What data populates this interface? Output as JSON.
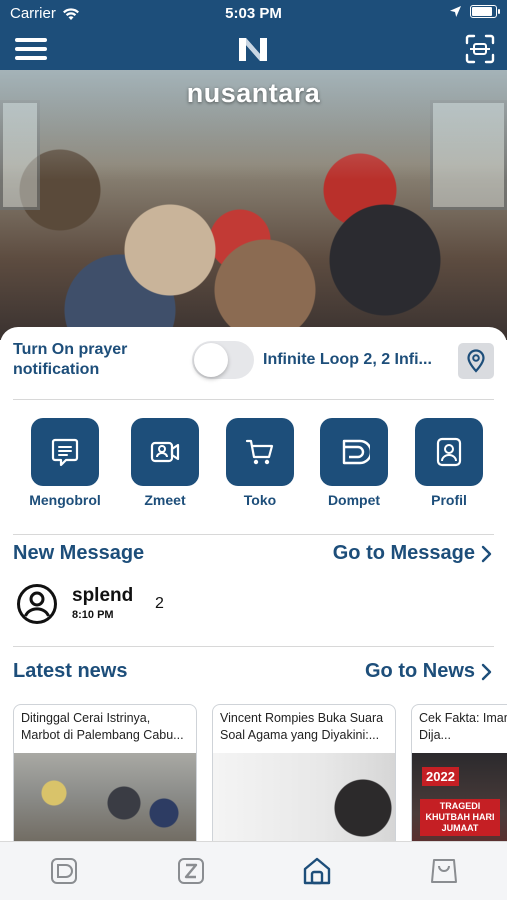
{
  "status_bar": {
    "carrier": "Carrier",
    "time": "5:03 PM",
    "battery_level": 0.9,
    "icons": [
      "wifi-icon",
      "location-arrow-icon",
      "battery-icon"
    ]
  },
  "header": {
    "menu_icon": "hamburger-menu-icon",
    "logo_icon": "n-logo-icon",
    "scan_icon": "qr-scan-icon",
    "background_color": "#1d4e7a"
  },
  "hero": {
    "title": "nusantara"
  },
  "prayer": {
    "label": "Turn On prayer notification",
    "toggle_on": false,
    "location": "Infinite Loop 2, 2 Infi...",
    "location_icon": "map-pin-icon"
  },
  "quick_actions": [
    {
      "label": "Mengobrol",
      "icon": "chat-icon"
    },
    {
      "label": "Zmeet",
      "icon": "video-call-icon"
    },
    {
      "label": "Toko",
      "icon": "cart-icon"
    },
    {
      "label": "Dompet",
      "icon": "wallet-icon"
    },
    {
      "label": "Profil",
      "icon": "profile-icon"
    }
  ],
  "messages": {
    "title": "New Message",
    "link": "Go to Message",
    "items": [
      {
        "name": "splend",
        "time": "8:10 PM",
        "count": "2"
      }
    ]
  },
  "news": {
    "title": "Latest news",
    "link": "Go to News",
    "items": [
      {
        "title": "Ditinggal Cerai Istrinya, Marbot di Palembang Cabu..."
      },
      {
        "title": "Vincent Rompies Buka Suara Soal Agama yang Diyakini:..."
      },
      {
        "title": "Cek Fakta: Imam Arab Saudi Dija...",
        "badge_year": "2022",
        "badge_text": "TRAGEDI KHUTBAH HARI JUMAAT"
      }
    ]
  },
  "tab_bar": {
    "tabs": [
      {
        "icon": "wallet-tab-icon",
        "active": false
      },
      {
        "icon": "z-tab-icon",
        "active": false
      },
      {
        "icon": "home-tab-icon",
        "active": true
      },
      {
        "icon": "shop-bag-tab-icon",
        "active": false
      }
    ],
    "active_color": "#1d4e7a",
    "inactive_color": "#8a8d91"
  }
}
